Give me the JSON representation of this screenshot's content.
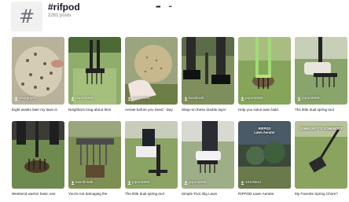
{
  "header": {
    "avatar_glyph": "#",
    "title": "#rifpod",
    "post_count": "2261 posts",
    "share_glyph": "➦",
    "more_glyph": "•••"
  },
  "videos": [
    {
      "username": "wiseguy03",
      "caption": "Eight weeks later my lawn is"
    },
    {
      "username": "j4p4rl4990",
      "caption": "Neighbors brag about their"
    },
    {
      "username": "j4p4rl4990",
      "caption": "Aerate before you Seed - Day"
    },
    {
      "username": "bossbuilt",
      "caption": "Strap-on these double layer"
    },
    {
      "username": "j4p4rl4990",
      "caption": "Help you solve lawn bald"
    },
    {
      "username": "j4p4rl4990",
      "caption": "The little dual spring tool"
    },
    {
      "username": "",
      "caption": "Weekend warrior basic one"
    },
    {
      "username": "lawnfixtalk",
      "caption": "You're not damaging the"
    },
    {
      "username": "j4p4rl4990",
      "caption": "The little dual spring tool"
    },
    {
      "username": "j4p4rl4990",
      "caption": "Simple Tool, Big Lawn"
    },
    {
      "username": "1010land",
      "caption": "RIFPOD Lawn Aerator"
    },
    {
      "username": "j4p4rl4990",
      "caption": "My Favorite Spring Chore?"
    }
  ],
  "overlays": {
    "v11": "RIFPOD\nLawn Aerator",
    "v12": "SOMEDAY IT'S SOMEBODY"
  }
}
